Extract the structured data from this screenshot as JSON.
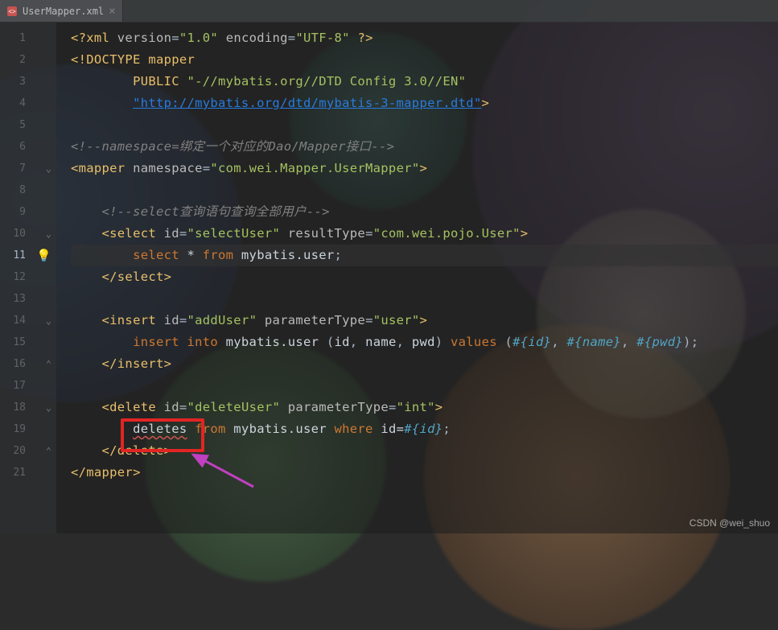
{
  "tab": {
    "filename": "UserMapper.xml",
    "close": "×"
  },
  "watermark": "CSDN @wei_shuo",
  "lines": {
    "l1": {
      "n": "1"
    },
    "l2": {
      "n": "2"
    },
    "l3": {
      "n": "3"
    },
    "l4": {
      "n": "4"
    },
    "l5": {
      "n": "5"
    },
    "l6": {
      "n": "6"
    },
    "l7": {
      "n": "7"
    },
    "l8": {
      "n": "8"
    },
    "l9": {
      "n": "9"
    },
    "l10": {
      "n": "10"
    },
    "l11": {
      "n": "11"
    },
    "l12": {
      "n": "12"
    },
    "l13": {
      "n": "13"
    },
    "l14": {
      "n": "14"
    },
    "l15": {
      "n": "15"
    },
    "l16": {
      "n": "16"
    },
    "l17": {
      "n": "17"
    },
    "l18": {
      "n": "18"
    },
    "l19": {
      "n": "19"
    },
    "l20": {
      "n": "20"
    },
    "l21": {
      "n": "21"
    }
  },
  "code": {
    "xmlDeclOpen": "<?xml ",
    "versionAttr": "version",
    "versionVal": "\"1.0\"",
    "encodingAttr": "encoding",
    "encodingVal": "\"UTF-8\"",
    "xmlDeclClose": " ?>",
    "doctype1": "<!DOCTYPE ",
    "doctypeName": "mapper",
    "public": "PUBLIC",
    "publicId": "\"-//mybatis.org//DTD Config 3.0//EN\"",
    "systemId": "\"http://mybatis.org/dtd/mybatis-3-mapper.dtd\"",
    "gt": ">",
    "eq": "=",
    "comment1": "<!--namespace=绑定一个对应的Dao/Mapper接口-->",
    "mapperOpen": "<",
    "mapperTag": "mapper",
    "namespaceAttr": "namespace",
    "namespaceVal": "\"com.wei.Mapper.UserMapper\"",
    "comment2": "<!--select查询语句查询全部用户-->",
    "selectTag": "select",
    "idAttr": "id",
    "selectUserVal": "\"selectUser\"",
    "resultTypeAttr": "resultType",
    "resultTypeVal": "\"com.wei.pojo.User\"",
    "selectKw": "select",
    "star": " * ",
    "fromKw": "from",
    "mybatisUser": " mybatis.user",
    "semi": ";",
    "closeOpen": "</",
    "insertTag": "insert",
    "addUserVal": "\"addUser\"",
    "paramTypeAttr": "parameterType",
    "userVal": "\"user\"",
    "insertKw": "insert",
    "intoKw": "into",
    "insertTarget": " mybatis.user ",
    "lpar": "(",
    "colId": "id",
    "comma": ", ",
    "colName": "name",
    "colPwd": "pwd",
    "rpar": ")",
    "valuesKw": " values ",
    "pOpen": "#{",
    "pClose": "}",
    "pId": "id",
    "pName": "name",
    "pPwd": "pwd",
    "deleteTag": "delete",
    "deleteUserVal": "\"deleteUser\"",
    "intVal": "\"int\"",
    "deletesErr": "deletes",
    "fromKw2": "from",
    "deleteTarget": " mybatis.user ",
    "whereKw": "where",
    "idEq": " id="
  }
}
